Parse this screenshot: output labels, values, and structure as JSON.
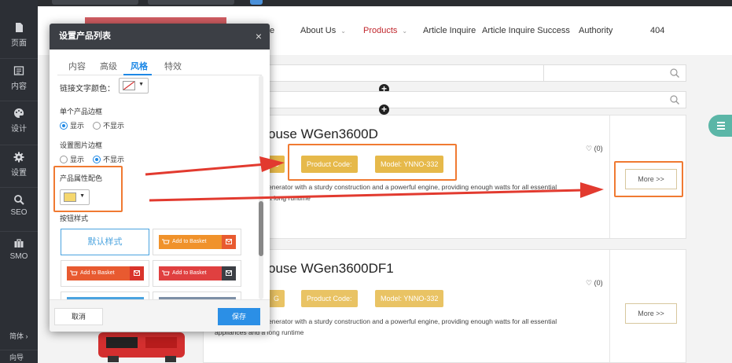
{
  "sidebar": {
    "items": [
      {
        "label": "页面",
        "icon": "page-icon"
      },
      {
        "label": "内容",
        "icon": "content-icon"
      },
      {
        "label": "设计",
        "icon": "palette-icon"
      },
      {
        "label": "设置",
        "icon": "gear-icon"
      },
      {
        "label": "SEO",
        "icon": "search-icon"
      },
      {
        "label": "SMO",
        "icon": "briefcase-icon"
      }
    ],
    "lang": "简体 ›",
    "guide": "向导"
  },
  "nav": {
    "items": [
      {
        "label": "e"
      },
      {
        "label": "About Us",
        "chevron": "⌄"
      },
      {
        "label": "Products",
        "chevron": "⌄"
      },
      {
        "label": "Article Inquire"
      },
      {
        "label": "Article Inquire Success"
      },
      {
        "label": "Authority"
      },
      {
        "label": "404"
      }
    ],
    "active_color": "#c1272d"
  },
  "products": [
    {
      "title": "ouse WGen3600D",
      "tags": [
        "G",
        "Product Code:",
        "Model: YNNO-332"
      ],
      "likes": "♡ (0)",
      "desc": [
        "enerator with a sturdy construction and a powerful engine, providing enough watts for all essential",
        "a long runtime"
      ],
      "more": "More >>"
    },
    {
      "title": "ouse WGen3600DF1",
      "tags": [
        "G",
        "Product Code:",
        "Model: YNNO-332"
      ],
      "likes": "♡ (0)",
      "desc": [
        "enerator with a sturdy construction and a powerful engine, providing enough watts for all essential",
        "appliances and a long runtime"
      ],
      "more": "More >>"
    }
  ],
  "dialog": {
    "title": "设置产品列表",
    "close": "×",
    "tabs": [
      "内容",
      "高级",
      "风格",
      "特效"
    ],
    "active_tab": "风格",
    "link_color_label": "链接文字颜色：",
    "border_label": "单个产品边框",
    "border_options": [
      "显示",
      "不显示"
    ],
    "img_border_label": "设置图片边框",
    "img_border_options": [
      "显示",
      "不显示"
    ],
    "attr_color_label": "产品属性配色",
    "attr_color": "#f5d76e",
    "btn_style_label": "按钮样式",
    "default_style": "默认样式",
    "basket_label": "Add to Basket",
    "basket_colors": [
      "#f0922b",
      "#e85a30",
      "#e04040"
    ],
    "cancel": "取消",
    "save": "保存"
  },
  "colors": {
    "accent": "#1e88e5",
    "highlight": "#f07a32",
    "arrow": "#e23a2f",
    "tag": "#e6b94a"
  }
}
